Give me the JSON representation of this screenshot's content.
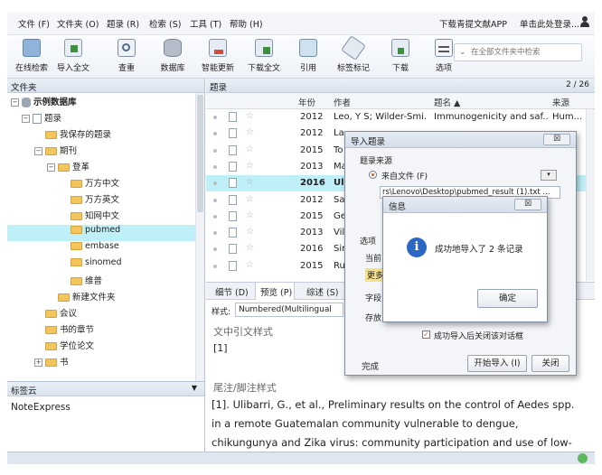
{
  "menu": [
    "文件 (F)",
    "文件夹 (O)",
    "题录 (R)",
    "检索 (S)",
    "工具 (T)",
    "帮助 (H)"
  ],
  "menu_right": {
    "download_app": "下载青提文献APP",
    "login": "单击此处登录..."
  },
  "toolbar": [
    "在线检索",
    "导入全文",
    "查重",
    "数据库",
    "智能更新",
    "下载全文",
    "引用",
    "标签标记",
    "下载",
    "选项"
  ],
  "search": {
    "placeholder": "在全部文件夹中检索"
  },
  "left": {
    "header": "文件夹",
    "tree": [
      {
        "label": "示例数据库",
        "bold": true
      },
      {
        "label": "题录"
      },
      {
        "label": "我保存的题录"
      },
      {
        "label": "期刊"
      },
      {
        "label": "登革"
      },
      {
        "label": "万方中文"
      },
      {
        "label": "万方英文"
      },
      {
        "label": "知网中文"
      },
      {
        "label": "pubmed",
        "selected": true
      },
      {
        "label": "embase"
      },
      {
        "label": "sinomed"
      },
      {
        "label": "维普"
      },
      {
        "label": "新建文件夹"
      },
      {
        "label": "会议"
      },
      {
        "label": "书的章节"
      },
      {
        "label": "学位论文"
      },
      {
        "label": "书"
      }
    ],
    "tag_header": "标签云",
    "tag_value": "NoteExpress"
  },
  "list": {
    "header": "题录",
    "page": "2 / 26",
    "columns": {
      "year": "年份",
      "author": "作者",
      "title": "题名 ▲",
      "source": "来源"
    },
    "rows": [
      {
        "year": "2012",
        "author": "Leo, Y S; Wilder-Smi...",
        "title": "Immunogenicity and saf...",
        "source": "Hum..."
      },
      {
        "year": "2012",
        "author": "La",
        "title": "",
        "source": ""
      },
      {
        "year": "2015",
        "author": "To",
        "title": "",
        "source": ""
      },
      {
        "year": "2013",
        "author": "Ma",
        "title": "",
        "source": ""
      },
      {
        "year": "2016",
        "author": "Ul",
        "title": "",
        "source": "",
        "bold": true
      },
      {
        "year": "2012",
        "author": "Sa",
        "title": "",
        "source": ""
      },
      {
        "year": "2015",
        "author": "Ge",
        "title": "",
        "source": ""
      },
      {
        "year": "2013",
        "author": "Vil",
        "title": "",
        "source": ""
      },
      {
        "year": "2016",
        "author": "Sin",
        "title": "",
        "source": ""
      },
      {
        "year": "2015",
        "author": "Ru",
        "title": "",
        "source": ""
      }
    ]
  },
  "tabs": [
    "细节 (D)",
    "预览 (P)",
    "综述 (S)"
  ],
  "preview": {
    "style_label": "样式:",
    "style_value": "Numbered(Multilingual",
    "intext_heading": "文中引文样式",
    "intext_value": "[1]",
    "foot_heading": "尾注/脚注样式",
    "foot_text": "[1].   Ulibarri, G., et al., Preliminary results on the control of Aedes spp. in a remote Guatemalan community vulnerable to dengue, chikungunya and Zika virus: community participation and use of low-"
  },
  "import_dialog": {
    "title": "导入题录",
    "close": "☒",
    "source_group": "题录来源",
    "from_file": "来自文件 (F)",
    "path": "rs\\Lenovo\\Desktop\\pubmed_result (1).txt ...",
    "options": "选项",
    "cur": "当前",
    "more": "更多",
    "field": "字段",
    "store": "存放",
    "close_after": "成功导入后关闭该对话框",
    "done": "完成",
    "start": "开始导入 (I)",
    "close_btn": "关闭"
  },
  "info_dialog": {
    "title": "信息",
    "close": "☒",
    "message": "成功地导入了 2 条记录",
    "ok": "确定"
  },
  "colors": {
    "selection": "#bff0f7",
    "accent": "#1f5fbf"
  }
}
